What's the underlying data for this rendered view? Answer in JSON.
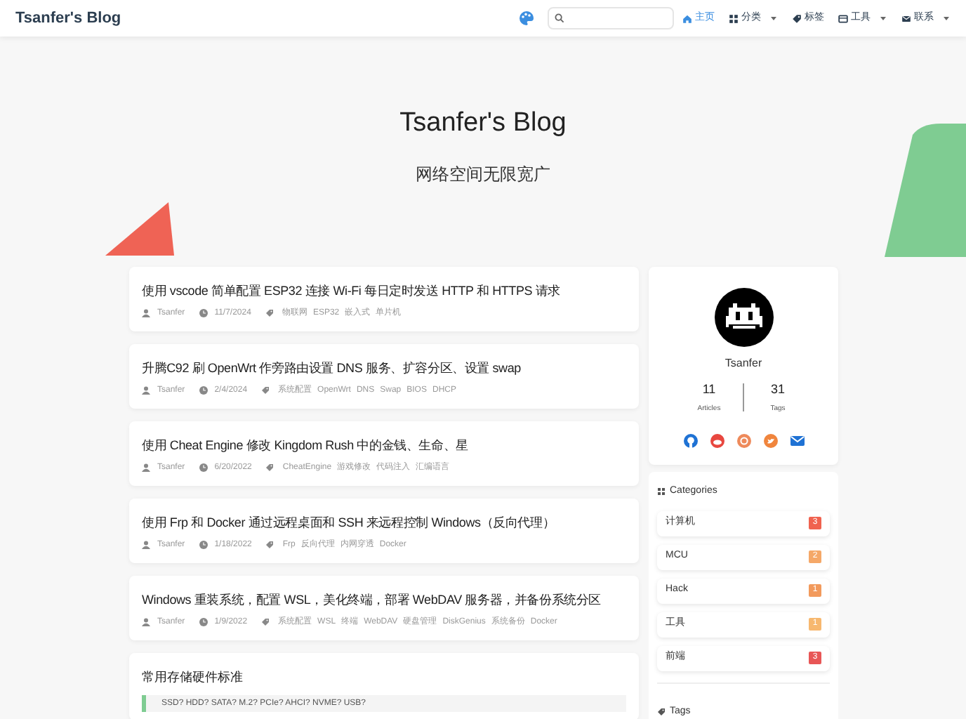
{
  "navbar": {
    "brand": "Tsanfer's Blog",
    "menu": [
      {
        "label": "主页",
        "dropdown": false,
        "selected": true
      },
      {
        "label": "分类",
        "dropdown": true,
        "selected": false
      },
      {
        "label": "标签",
        "dropdown": false,
        "selected": false
      },
      {
        "label": "工具",
        "dropdown": true,
        "selected": false
      },
      {
        "label": "联系",
        "dropdown": true,
        "selected": false
      }
    ]
  },
  "hero": {
    "title": "Tsanfer's Blog",
    "subtitle": "网络空间无限宽广"
  },
  "posts": [
    {
      "title": "使用 vscode 简单配置 ESP32 连接 Wi-Fi 每日定时发送 HTTP 和 HTTPS 请求",
      "author": "Tsanfer",
      "date": "11/7/2024",
      "tags": [
        "物联网",
        "ESP32",
        "嵌入式",
        "单片机"
      ]
    },
    {
      "title": "升腾C92 刷 OpenWrt 作旁路由设置 DNS 服务、扩容分区、设置 swap",
      "author": "Tsanfer",
      "date": "2/4/2024",
      "tags": [
        "系统配置",
        "OpenWrt",
        "DNS",
        "Swap",
        "BIOS",
        "DHCP"
      ]
    },
    {
      "title": "使用 Cheat Engine 修改 Kingdom Rush 中的金钱、生命、星",
      "author": "Tsanfer",
      "date": "6/20/2022",
      "tags": [
        "CheatEngine",
        "游戏修改",
        "代码注入",
        "汇编语言"
      ]
    },
    {
      "title": "使用 Frp 和 Docker 通过远程桌面和 SSH 来远程控制 Windows（反向代理）",
      "author": "Tsanfer",
      "date": "1/18/2022",
      "tags": [
        "Frp",
        "反向代理",
        "内网穿透",
        "Docker"
      ]
    },
    {
      "title": "Windows 重装系统，配置 WSL，美化终端，部署 WebDAV 服务器，并备份系统分区",
      "author": "Tsanfer",
      "date": "1/9/2022",
      "tags": [
        "系统配置",
        "WSL",
        "终端",
        "WebDAV",
        "硬盘管理",
        "DiskGenius",
        "系统备份",
        "Docker"
      ]
    }
  ],
  "excerpt": {
    "title": "常用存储硬件标准",
    "quote": "SSD? HDD? SATA? M.2? PCIe? AHCI? NVME? USB?"
  },
  "profile": {
    "name": "Tsanfer",
    "stats": [
      {
        "value": "11",
        "label": "Articles"
      },
      {
        "value": "31",
        "label": "Tags"
      }
    ]
  },
  "categories": {
    "heading": "Categories",
    "items": [
      {
        "name": "计算机",
        "count": "3",
        "color": "#f0624f"
      },
      {
        "name": "MCU",
        "count": "2",
        "color": "#f5a868"
      },
      {
        "name": "Hack",
        "count": "1",
        "color": "#f29a5c"
      },
      {
        "name": "工具",
        "count": "1",
        "color": "#f7b86f"
      },
      {
        "name": "前端",
        "count": "3",
        "color": "#e85656"
      }
    ]
  },
  "tags_heading": "Tags"
}
